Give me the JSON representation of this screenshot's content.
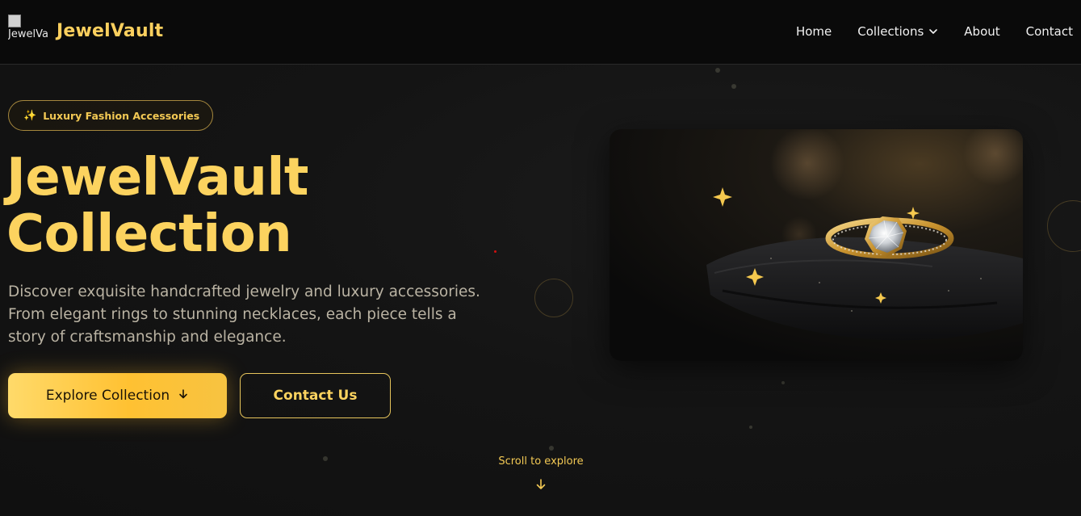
{
  "nav": {
    "logo_alt": "JewelVault",
    "brand": "JewelVault",
    "links": [
      {
        "label": "Home"
      },
      {
        "label": "Collections",
        "icon": "chevron-down-icon"
      },
      {
        "label": "About"
      },
      {
        "label": "Contact"
      }
    ]
  },
  "hero": {
    "badge_icon": "sparkles-icon",
    "badge_text": "Luxury Fashion Accessories",
    "title_line1": "JewelVault",
    "title_line2": "Collection",
    "description": "Discover exquisite handcrafted jewelry and luxury accessories. From elegant rings to stunning necklaces, each piece tells a story of craftsmanship and elegance.",
    "primary_button": "Explore Collection",
    "primary_button_icon": "arrow-down-icon",
    "secondary_button": "Contact Us",
    "scroll_hint": "Scroll to explore",
    "image": "gold-diamond-ring-image"
  },
  "colors": {
    "accent": "#fcd35f",
    "background": "#131313",
    "navbar": "#0a0a0a"
  }
}
